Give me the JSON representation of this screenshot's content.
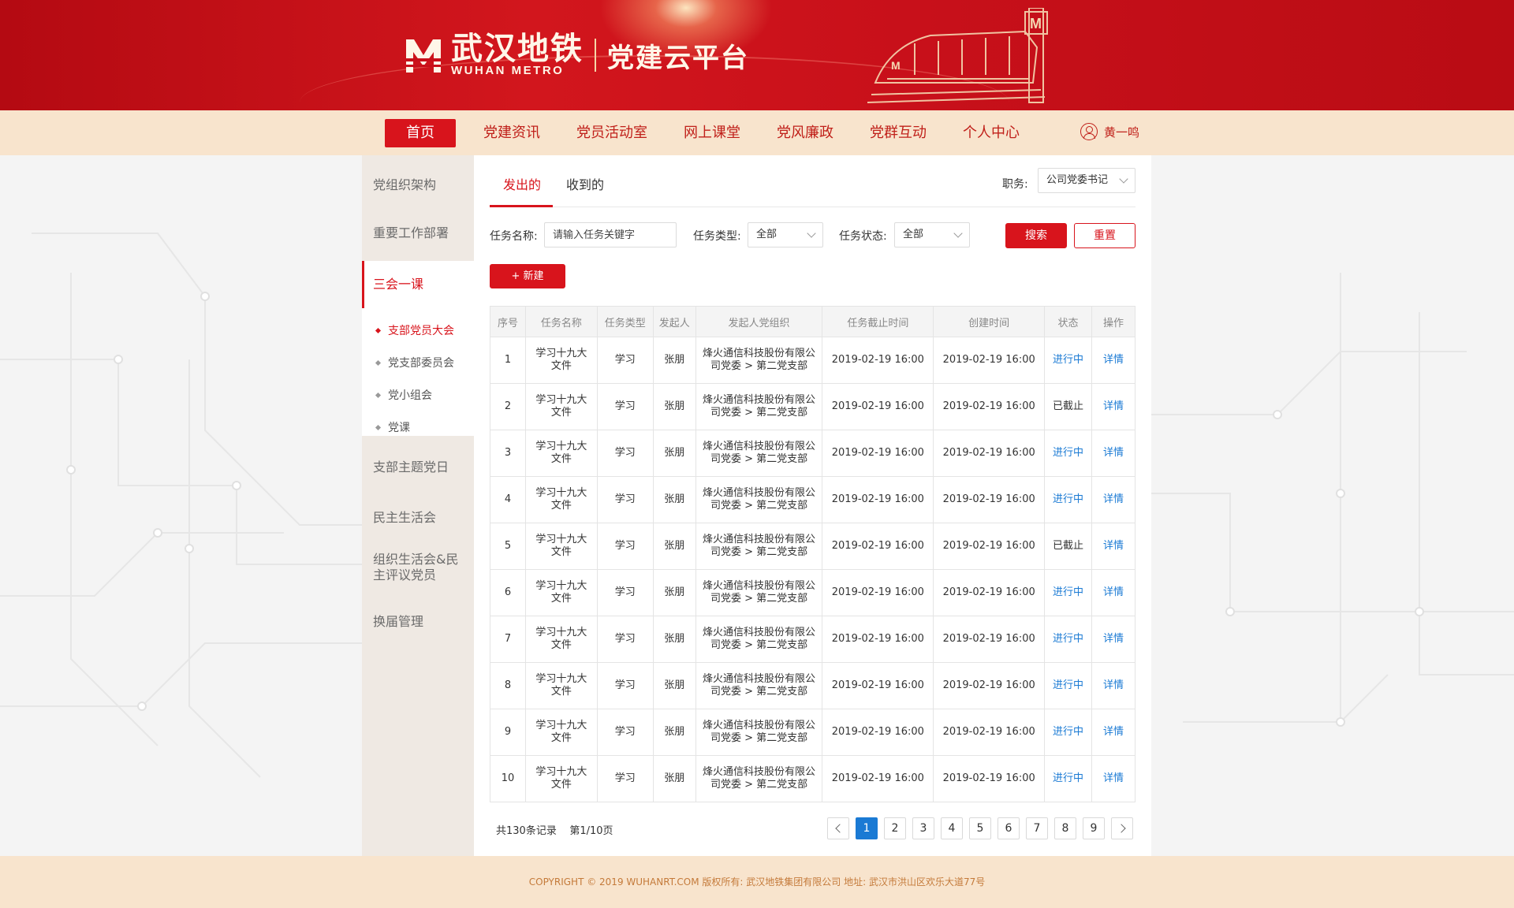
{
  "brand": {
    "cn_name": "武汉地铁",
    "en_name": "WUHAN METRO",
    "platform": "党建云平台",
    "logo_letter": "M"
  },
  "nav": {
    "items": [
      "首页",
      "党建资讯",
      "党员活动室",
      "网上课堂",
      "党风廉政",
      "党群互动",
      "个人中心"
    ],
    "active_index": 0,
    "user_name": "黄一鸣"
  },
  "sidebar": {
    "items": [
      "党组织架构",
      "重要工作部署",
      "三会一课",
      "支部主题党日",
      "民主生活会",
      "组织生活会&民主评议党员",
      "换届管理"
    ],
    "active": "三会一课",
    "sub_items": [
      "支部党员大会",
      "党支部委员会",
      "党小组会",
      "党课"
    ],
    "active_sub": "支部党员大会"
  },
  "tabs": [
    "发出的",
    "收到的"
  ],
  "duty": {
    "label": "职务:",
    "value": "公司党委书记"
  },
  "filters": {
    "name_label": "任务名称:",
    "name_placeholder": "请输入任务关键字",
    "type_label": "任务类型:",
    "type_value": "全部",
    "status_label": "任务状态:",
    "status_value": "全部",
    "search_label": "搜索",
    "reset_label": "重置"
  },
  "new_button": "+ 新建",
  "table": {
    "columns": [
      "序号",
      "任务名称",
      "任务类型",
      "发起人",
      "发起人党组织",
      "任务截止时间",
      "创建时间",
      "状态",
      "操作"
    ],
    "rows": [
      {
        "no": "1",
        "name": "学习十九大文件",
        "type": "学习",
        "initiator": "张朋",
        "org": "烽火通信科技股份有限公司党委 > 第二党支部",
        "deadline": "2019-02-19 16:00",
        "created": "2019-02-19 16:00",
        "status": "进行中",
        "action": "详情"
      },
      {
        "no": "2",
        "name": "学习十九大文件",
        "type": "学习",
        "initiator": "张朋",
        "org": "烽火通信科技股份有限公司党委 > 第二党支部",
        "deadline": "2019-02-19 16:00",
        "created": "2019-02-19 16:00",
        "status": "已截止",
        "action": "详情"
      },
      {
        "no": "3",
        "name": "学习十九大文件",
        "type": "学习",
        "initiator": "张朋",
        "org": "烽火通信科技股份有限公司党委 > 第二党支部",
        "deadline": "2019-02-19 16:00",
        "created": "2019-02-19 16:00",
        "status": "进行中",
        "action": "详情"
      },
      {
        "no": "4",
        "name": "学习十九大文件",
        "type": "学习",
        "initiator": "张朋",
        "org": "烽火通信科技股份有限公司党委 > 第二党支部",
        "deadline": "2019-02-19 16:00",
        "created": "2019-02-19 16:00",
        "status": "进行中",
        "action": "详情"
      },
      {
        "no": "5",
        "name": "学习十九大文件",
        "type": "学习",
        "initiator": "张朋",
        "org": "烽火通信科技股份有限公司党委 > 第二党支部",
        "deadline": "2019-02-19 16:00",
        "created": "2019-02-19 16:00",
        "status": "已截止",
        "action": "详情"
      },
      {
        "no": "6",
        "name": "学习十九大文件",
        "type": "学习",
        "initiator": "张朋",
        "org": "烽火通信科技股份有限公司党委 > 第二党支部",
        "deadline": "2019-02-19 16:00",
        "created": "2019-02-19 16:00",
        "status": "进行中",
        "action": "详情"
      },
      {
        "no": "7",
        "name": "学习十九大文件",
        "type": "学习",
        "initiator": "张朋",
        "org": "烽火通信科技股份有限公司党委 > 第二党支部",
        "deadline": "2019-02-19 16:00",
        "created": "2019-02-19 16:00",
        "status": "进行中",
        "action": "详情"
      },
      {
        "no": "8",
        "name": "学习十九大文件",
        "type": "学习",
        "initiator": "张朋",
        "org": "烽火通信科技股份有限公司党委 > 第二党支部",
        "deadline": "2019-02-19 16:00",
        "created": "2019-02-19 16:00",
        "status": "进行中",
        "action": "详情"
      },
      {
        "no": "9",
        "name": "学习十九大文件",
        "type": "学习",
        "initiator": "张朋",
        "org": "烽火通信科技股份有限公司党委 > 第二党支部",
        "deadline": "2019-02-19 16:00",
        "created": "2019-02-19 16:00",
        "status": "进行中",
        "action": "详情"
      },
      {
        "no": "10",
        "name": "学习十九大文件",
        "type": "学习",
        "initiator": "张朋",
        "org": "烽火通信科技股份有限公司党委 > 第二党支部",
        "deadline": "2019-02-19 16:00",
        "created": "2019-02-19 16:00",
        "status": "进行中",
        "action": "详情"
      }
    ]
  },
  "pagination": {
    "total_text": "共130条记录",
    "page_text": "第1/10页",
    "pages": [
      "1",
      "2",
      "3",
      "4",
      "5",
      "6",
      "7",
      "8",
      "9"
    ],
    "current": "1"
  },
  "footer": "COPYRIGHT © 2019 WUHANRT.COM  版权所有: 武汉地铁集团有限公司  地址: 武汉市洪山区欢乐大道77号",
  "colors": {
    "brand_red": "#d8141c",
    "nav_bg": "#f8e4cd",
    "link_blue": "#1a7ad4"
  }
}
